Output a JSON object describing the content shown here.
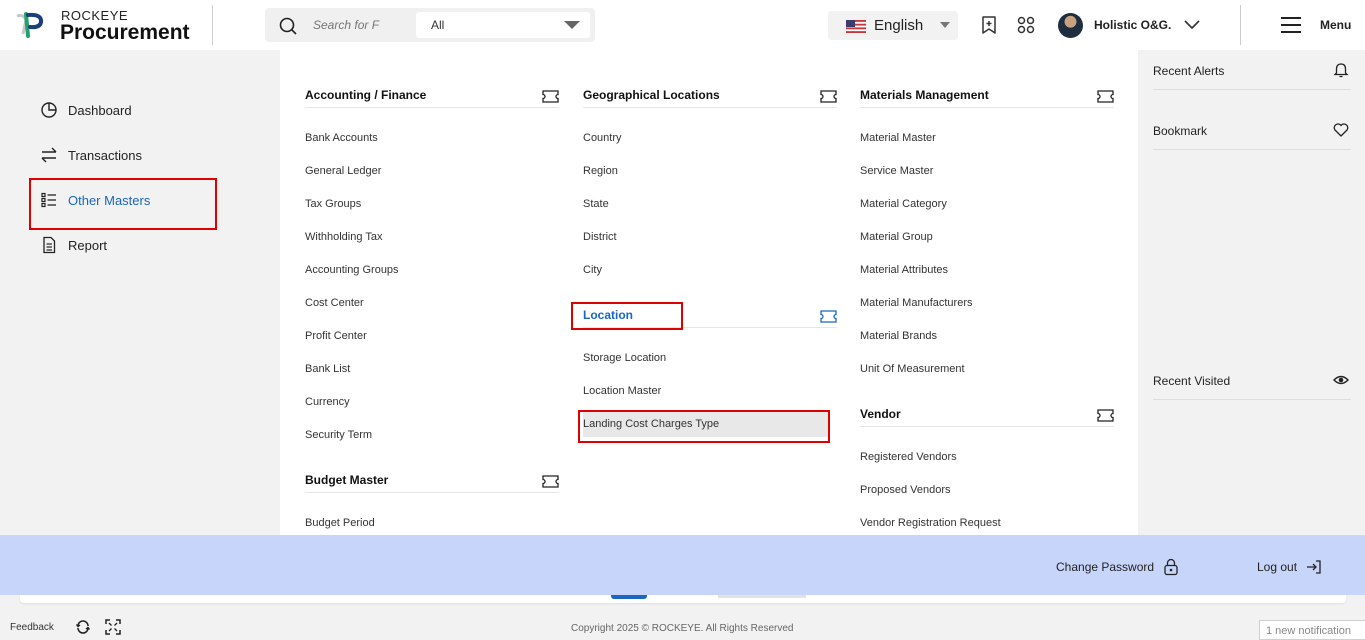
{
  "header": {
    "brand_small": "ROCKEYE",
    "brand_big": "Procurement",
    "search_placeholder": "Search for F",
    "search_scope": "All",
    "language": "English",
    "user_name": "Holistic O&G.",
    "menu_label": "Menu"
  },
  "sidebar": {
    "items": [
      {
        "label": "Dashboard",
        "icon": "dashboard-icon"
      },
      {
        "label": "Transactions",
        "icon": "transfer-arrows-icon"
      },
      {
        "label": "Other Masters",
        "icon": "list-icon",
        "active": true
      },
      {
        "label": "Report",
        "icon": "document-icon"
      }
    ]
  },
  "mega_menu": {
    "col1": {
      "section1": {
        "title": "Accounting / Finance",
        "items": [
          "Bank Accounts",
          "General Ledger",
          "Tax Groups",
          "Withholding Tax",
          "Accounting Groups",
          "Cost Center",
          "Profit Center",
          "Bank List",
          "Currency",
          "Security Term"
        ]
      },
      "section2": {
        "title": "Budget Master",
        "items": [
          "Budget Period"
        ]
      }
    },
    "col2": {
      "section1": {
        "title": "Geographical Locations",
        "items": [
          "Country",
          "Region",
          "State",
          "District",
          "City"
        ]
      },
      "section2": {
        "title": "Location",
        "items": [
          "Storage Location",
          "Location Master",
          "Landing Cost Charges Type"
        ]
      }
    },
    "col3": {
      "section1": {
        "title": "Materials Management",
        "items": [
          "Material Master",
          "Service Master",
          "Material Category",
          "Material Group",
          "Material Attributes",
          "Material Manufacturers",
          "Material Brands",
          "Unit Of Measurement"
        ]
      },
      "section2": {
        "title": "Vendor",
        "items": [
          "Registered Vendors",
          "Proposed Vendors",
          "Vendor Registration Request"
        ]
      }
    }
  },
  "right_panel": {
    "recent_alerts": "Recent Alerts",
    "bookmark": "Bookmark",
    "recent_visited": "Recent Visited"
  },
  "bottom_bar": {
    "change_password": "Change Password",
    "log_out": "Log out"
  },
  "footer": {
    "feedback": "Feedback",
    "copyright": "Copyright 2025 © ROCKEYE. All Rights Reserved",
    "notification": "1 new notification"
  },
  "colors": {
    "accent": "#1a66c0",
    "highlight_border": "#e00000",
    "bottom_bar": "#c7d5fa"
  }
}
